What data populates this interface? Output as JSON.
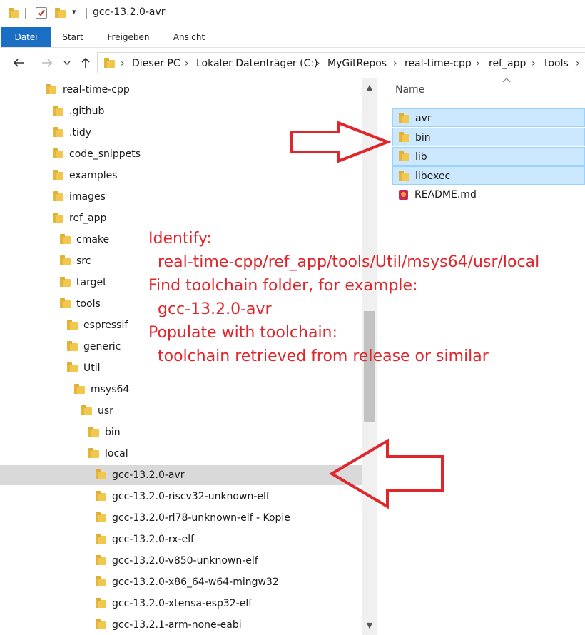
{
  "window": {
    "title": "gcc-13.2.0-avr"
  },
  "quick_access": {
    "dropdown_glyph": "▾"
  },
  "ribbon": {
    "tabs": [
      "Datei",
      "Start",
      "Freigeben",
      "Ansicht"
    ],
    "active": "Datei",
    "accent": "#1a6fc4"
  },
  "nav": {
    "back_icon": "arrow-left-icon",
    "forward_icon": "arrow-right-icon",
    "up_icon": "arrow-up-icon"
  },
  "address": {
    "crumbs": [
      "Dieser PC",
      "Lokaler Datenträger (C:)",
      "MyGitRepos",
      "real-time-cpp",
      "ref_app",
      "tools"
    ],
    "separator": "›"
  },
  "tree": {
    "items": [
      {
        "label": "real-time-cpp"
      },
      {
        "label": ".github"
      },
      {
        "label": ".tidy"
      },
      {
        "label": "code_snippets"
      },
      {
        "label": "examples"
      },
      {
        "label": "images"
      },
      {
        "label": "ref_app"
      },
      {
        "label": "cmake"
      },
      {
        "label": "src"
      },
      {
        "label": "target"
      },
      {
        "label": "tools"
      },
      {
        "label": "espressif"
      },
      {
        "label": "generic"
      },
      {
        "label": "Util"
      },
      {
        "label": "msys64"
      },
      {
        "label": "usr"
      },
      {
        "label": "bin"
      },
      {
        "label": "local"
      },
      {
        "label": "gcc-13.2.0-avr",
        "selected": true
      },
      {
        "label": "gcc-13.2.0-riscv32-unknown-elf"
      },
      {
        "label": "gcc-13.2.0-rl78-unknown-elf - Kopie"
      },
      {
        "label": "gcc-13.2.0-rx-elf"
      },
      {
        "label": "gcc-13.2.0-v850-unknown-elf"
      },
      {
        "label": "gcc-13.2.0-x86_64-w64-mingw32"
      },
      {
        "label": "gcc-13.2.0-xtensa-esp32-elf"
      },
      {
        "label": "gcc-13.2.1-arm-none-eabi"
      }
    ]
  },
  "files": {
    "header": "Name",
    "items": [
      {
        "label": "avr",
        "type": "folder",
        "selected": true
      },
      {
        "label": "bin",
        "type": "folder",
        "selected": true
      },
      {
        "label": "lib",
        "type": "folder",
        "selected": true
      },
      {
        "label": "libexec",
        "type": "folder",
        "selected": true
      },
      {
        "label": "README.md",
        "type": "markdown-file",
        "selected": false
      }
    ]
  },
  "annotation": {
    "color": "#e0262b",
    "lines": [
      "Identify:",
      "real-time-cpp/ref_app/tools/Util/msys64/usr/local",
      "Find toolchain folder, for example:",
      "gcc-13.2.0-avr",
      "Populate with toolchain:",
      "toolchain retrieved from release or similar"
    ]
  },
  "scrollbar": {
    "up": "▲",
    "down": "▼"
  }
}
